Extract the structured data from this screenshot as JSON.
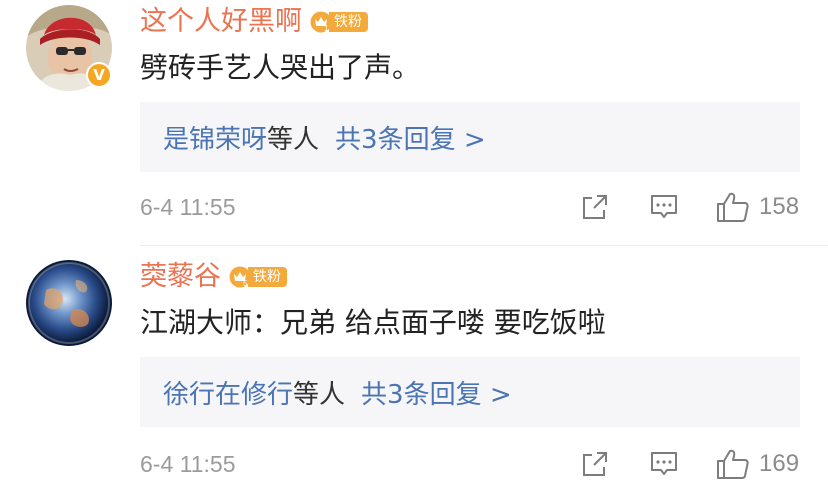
{
  "comments": [
    {
      "username": "这个人好黑啊",
      "fan_badge": {
        "level": "1",
        "label": "铁粉"
      },
      "verified": "V",
      "text": "劈砖手艺人哭出了声。",
      "reply_summary": {
        "user": "是锦荣呀",
        "etc": "等人",
        "count_text": "共3条回复 >"
      },
      "time": "6-4 11:55",
      "likes": "158",
      "icons": [
        "share-icon",
        "reply-icon",
        "like-icon"
      ]
    },
    {
      "username": "葖藜谷",
      "fan_badge": {
        "level": "5",
        "label": "铁粉"
      },
      "text": "江湖大师：兄弟  给点面子喽  要吃饭啦",
      "reply_summary": {
        "user": "徐行在修行",
        "etc": "等人",
        "count_text": "共3条回复 >"
      },
      "time": "6-4 11:55",
      "likes": "169",
      "icons": [
        "share-icon",
        "reply-icon",
        "like-icon"
      ]
    }
  ],
  "colors": {
    "username": "#eb7350",
    "link": "#4a74b4",
    "badge": "#f4a93b",
    "reply_bg": "#f6f6f8",
    "meta": "#9b9b9b"
  }
}
